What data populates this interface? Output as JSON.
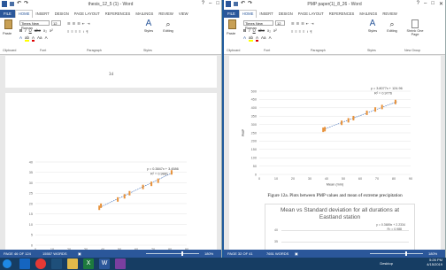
{
  "left_window": {
    "title": "thesis_12_5 (1) - Word",
    "tabs": [
      "FILE",
      "HOME",
      "INSERT",
      "DESIGN",
      "PAGE LAYOUT",
      "REFERENCES",
      "MAILINGS",
      "REVIEW",
      "VIEW"
    ],
    "active_tab": "HOME",
    "font_name": "Times New Roman",
    "font_size": "12",
    "paste_label": "Paste",
    "styles_label": "Styles",
    "editing_label": "Editing",
    "group_labels": [
      "Clipboard",
      "Font",
      "Paragraph",
      "Styles"
    ],
    "page_number": "34",
    "chart_data": {
      "type": "scatter",
      "equation": "y = 0.3847x + 3.4586",
      "r2": "R² = 0.9881",
      "xlim": [
        0,
        90
      ],
      "ylim": [
        0,
        40
      ],
      "x_ticks": [
        "0",
        "10",
        "20",
        "30",
        "40",
        "50",
        "60",
        "70",
        "80",
        "90"
      ],
      "y_ticks": [
        "0",
        "5",
        "10",
        "15",
        "20",
        "25",
        "30",
        "35",
        "40"
      ],
      "x": [
        38,
        39,
        49,
        53,
        56,
        64,
        69,
        73,
        81
      ],
      "y": [
        18,
        19,
        22,
        23.5,
        25,
        28,
        29.5,
        31,
        35
      ],
      "trendline": {
        "slope": 0.3847,
        "intercept": 3.4586,
        "x_range": [
          38,
          82
        ]
      }
    },
    "status": {
      "page": "PAGE 46 OF 124",
      "words": "15557 WORDS",
      "zoom": "180%"
    }
  },
  "right_window": {
    "title": "PMP paper(1)_8_26 - Word",
    "tabs": [
      "FILE",
      "HOME",
      "INSERT",
      "DESIGN",
      "PAGE LAYOUT",
      "REFERENCES",
      "MAILINGS",
      "REVIEW"
    ],
    "active_tab": "HOME",
    "font_name": "Times New Roman",
    "font_size": "12",
    "paste_label": "Paste",
    "styles_label": "Styles",
    "editing_label": "Editing",
    "shrink_label": "Shrink One Page",
    "group_labels": [
      "Clipboard",
      "Font",
      "Paragraph",
      "Styles",
      "New Group"
    ],
    "chart_data": {
      "type": "scatter",
      "equation": "y = 3.8077x + 124.96",
      "r2": "R² = 0.9776",
      "xlabel": "Mean (mm)",
      "ylabel": "PMP",
      "xlim": [
        0,
        90
      ],
      "ylim": [
        0,
        500
      ],
      "x_ticks": [
        "0",
        "10",
        "20",
        "30",
        "40",
        "50",
        "60",
        "70",
        "80",
        "90"
      ],
      "y_ticks": [
        "0",
        "50",
        "100",
        "150",
        "200",
        "250",
        "300",
        "350",
        "400",
        "450",
        "500"
      ],
      "x": [
        38,
        39,
        49,
        53,
        56,
        64,
        69,
        73,
        81
      ],
      "y": [
        268,
        272,
        310,
        325,
        338,
        370,
        390,
        405,
        435
      ],
      "trendline": {
        "slope": 3.8077,
        "intercept": 124.96,
        "x_range": [
          38,
          82
        ]
      }
    },
    "figure_caption": "Figure 12a. Plots between PMP values and mean of extreme precipitation",
    "second_chart": {
      "title": "Mean vs Standard deviation for all durations at Eastland station",
      "equation": "y = 0.3689x + 2.2334",
      "r2": "R² = 0.988",
      "y_ticks": [
        "40",
        "35"
      ]
    },
    "status": {
      "page": "PAGE 32 OF 41",
      "words": "7651 WORDS",
      "zoom": "180%"
    }
  },
  "taskbar": {
    "time": "5:26 PM",
    "date": "4/15/2019",
    "desktop_label": "Desktop"
  },
  "colors": {
    "word_blue": "#2b579a",
    "marker_orange": "#e8923a",
    "trend_blue": "#2b5fb0"
  }
}
